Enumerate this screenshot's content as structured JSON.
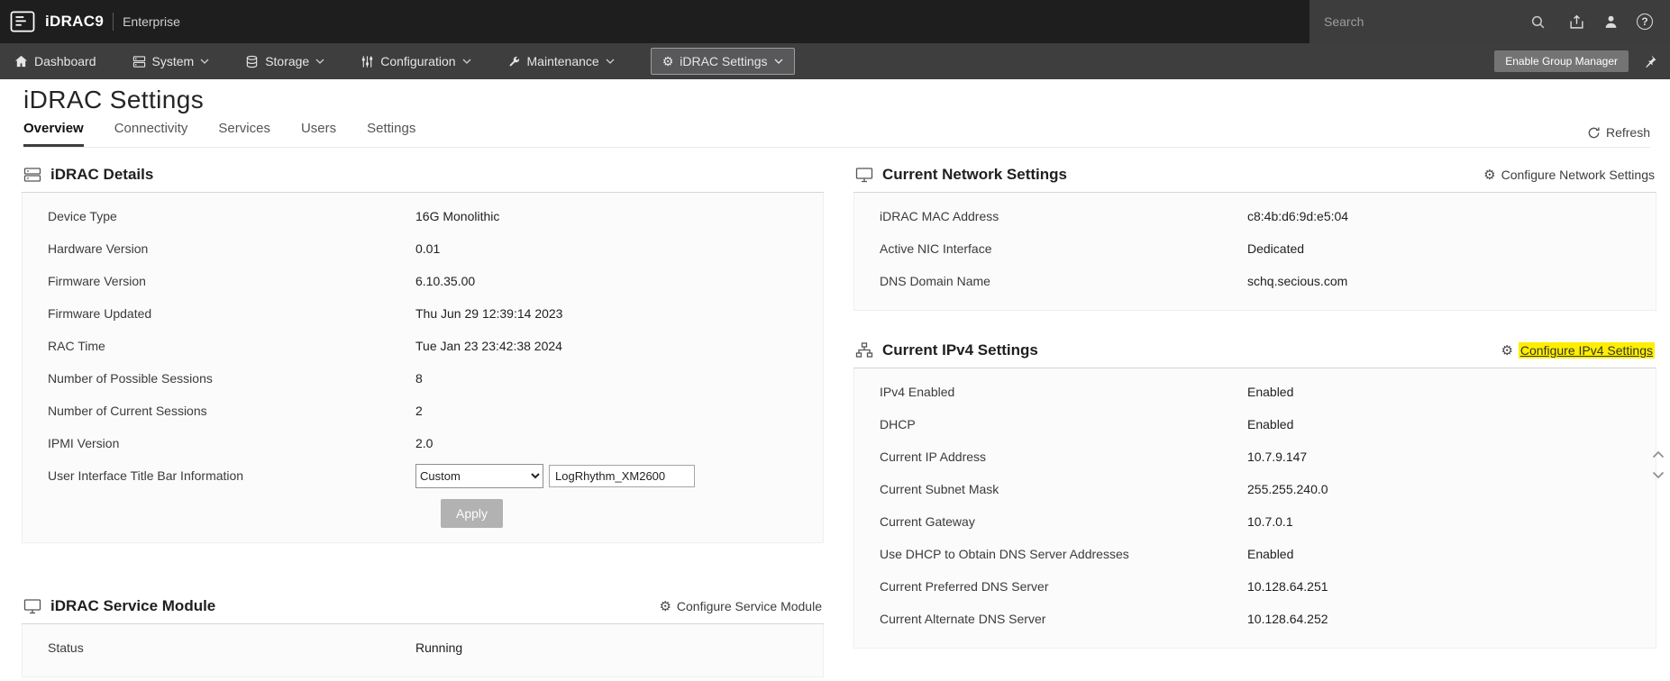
{
  "colors": {
    "topbar_bg": "#1e1e1e",
    "header_right_bg": "#3d3d3d",
    "navbar_bg": "#3e3e3e",
    "find_highlight": "#ffee00"
  },
  "icons": {
    "gear_glyph": "⚙",
    "help_glyph": "?"
  },
  "header": {
    "brand": "iDRAC9",
    "edition": "Enterprise",
    "search_placeholder": "Search"
  },
  "nav": {
    "items": [
      {
        "label": "Dashboard",
        "dropdown": false,
        "active": false
      },
      {
        "label": "System",
        "dropdown": true,
        "active": false
      },
      {
        "label": "Storage",
        "dropdown": true,
        "active": false
      },
      {
        "label": "Configuration",
        "dropdown": true,
        "active": false
      },
      {
        "label": "Maintenance",
        "dropdown": true,
        "active": false
      },
      {
        "label": "iDRAC Settings",
        "dropdown": true,
        "active": true
      }
    ],
    "enable_group_manager": "Enable Group Manager"
  },
  "page": {
    "title": "iDRAC Settings",
    "tabs": [
      "Overview",
      "Connectivity",
      "Services",
      "Users",
      "Settings"
    ],
    "active_tab": "Overview",
    "refresh_label": "Refresh"
  },
  "idrac_details": {
    "title": "iDRAC Details",
    "rows": [
      {
        "label": "Device Type",
        "value": "16G Monolithic"
      },
      {
        "label": "Hardware Version",
        "value": "0.01"
      },
      {
        "label": "Firmware Version",
        "value": "6.10.35.00"
      },
      {
        "label": "Firmware Updated",
        "value": "Thu Jun 29 12:39:14 2023"
      },
      {
        "label": "RAC Time",
        "value": "Tue Jan 23 23:42:38 2024"
      },
      {
        "label": "Number of Possible Sessions",
        "value": "8"
      },
      {
        "label": "Number of Current Sessions",
        "value": "2"
      },
      {
        "label": "IPMI Version",
        "value": "2.0"
      }
    ],
    "title_bar_row": {
      "label": "User Interface Title Bar Information",
      "select_value": "Custom",
      "input_value": "LogRhythm_XM2600",
      "apply_label": "Apply"
    }
  },
  "service_module": {
    "title": "iDRAC Service Module",
    "configure_label": "Configure Service Module",
    "rows": [
      {
        "label": "Status",
        "value": "Running"
      }
    ]
  },
  "network_settings": {
    "title": "Current Network Settings",
    "configure_label": "Configure Network Settings",
    "rows": [
      {
        "label": "iDRAC MAC Address",
        "value": "c8:4b:d6:9d:e5:04"
      },
      {
        "label": "Active NIC Interface",
        "value": "Dedicated"
      },
      {
        "label": "DNS Domain Name",
        "value": "schq.secious.com"
      }
    ]
  },
  "ipv4_settings": {
    "title": "Current IPv4 Settings",
    "configure_label": "Configure IPv4 Settings",
    "rows": [
      {
        "label": "IPv4 Enabled",
        "value": "Enabled"
      },
      {
        "label": "DHCP",
        "value": "Enabled"
      },
      {
        "label": "Current IP Address",
        "value": "10.7.9.147"
      },
      {
        "label": "Current Subnet Mask",
        "value": "255.255.240.0"
      },
      {
        "label": "Current Gateway",
        "value": "10.7.0.1"
      },
      {
        "label": "Use DHCP to Obtain DNS Server Addresses",
        "value": "Enabled"
      },
      {
        "label": "Current Preferred DNS Server",
        "value": "10.128.64.251"
      },
      {
        "label": "Current Alternate DNS Server",
        "value": "10.128.64.252"
      }
    ]
  }
}
